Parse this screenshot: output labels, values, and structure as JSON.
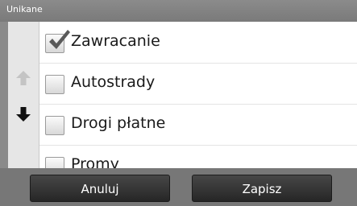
{
  "header": {
    "title": "Unikane"
  },
  "list": {
    "items": [
      {
        "label": "Zawracanie",
        "checked": true
      },
      {
        "label": "Autostrady",
        "checked": false
      },
      {
        "label": "Drogi płatne",
        "checked": false
      },
      {
        "label": "Promy",
        "checked": false
      }
    ]
  },
  "scroll": {
    "up_icon": "arrow-up-icon",
    "down_icon": "arrow-down-icon",
    "up_enabled": false,
    "down_enabled": true
  },
  "footer": {
    "cancel_label": "Anuluj",
    "save_label": "Zapisz"
  },
  "colors": {
    "header_bg": "#808080",
    "button_bg": "#333333",
    "footer_bg": "#777777",
    "scroll_up_disabled": "#c4c4c4",
    "scroll_down_enabled": "#111111"
  }
}
